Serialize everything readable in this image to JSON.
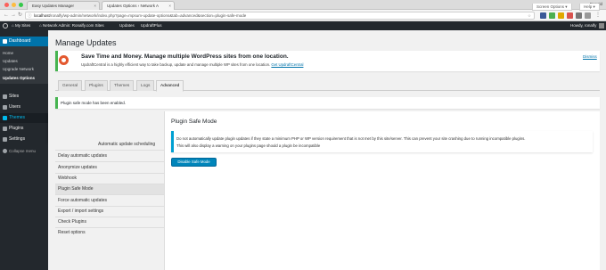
{
  "browser": {
    "tabs": [
      {
        "label": "Easy Updates Manager",
        "active": false
      },
      {
        "label": "Updates Options ‹ Network A",
        "active": true
      }
    ],
    "profile": "Ronald",
    "url_host": "localhost",
    "url_path": "/ronalfy/wp-admin/network/index.php?page=mpsum-update-options&tab=advanced&section=plugin-safe-mode"
  },
  "adminbar": {
    "my_sites": "My Sites",
    "network": "Network Admin: Ronalfy.com Sites",
    "updates": "Updates",
    "updraft": "UpdraftPlus",
    "howdy": "Howdy, ronalfy"
  },
  "sidebar": {
    "dashboard": "Dashboard",
    "dashboard_sub": [
      "Home",
      "Updates",
      "Upgrade Network",
      "Updates Options"
    ],
    "items": [
      "Sites",
      "Users",
      "Themes",
      "Plugins",
      "Settings"
    ],
    "collapse": "Collapse menu",
    "themes_flyout": [
      "Installed Themes",
      "Add New",
      "Editor"
    ]
  },
  "screen_options": "Screen Options ▾",
  "help": "Help ▾",
  "page_title": "Manage Updates",
  "notice": {
    "heading": "Save Time and Money. Manage multiple WordPress sites from one location.",
    "text": "UpdraftCentral is a highly efficient way to take backup, update and manage multiple WP sites from one location.",
    "link": "Get UpdraftCentral",
    "dismiss": "Dismiss"
  },
  "tabs": [
    "General",
    "Plugins",
    "Themes",
    "Logs",
    "Advanced"
  ],
  "success_message": "Plugin safe mode has been enabled.",
  "advanced_nav": [
    "Automatic update scheduling",
    "Delay automatic updates",
    "Anonymize updates",
    "Webhook",
    "Plugin Safe Mode",
    "Force automatic updates",
    "Export / import settings",
    "Check Plugins",
    "Reset options"
  ],
  "advanced_nav_active": "Plugin Safe Mode",
  "panel": {
    "title": "Plugin Safe Mode",
    "info_line1": "Do not automatically update plugin updates if they state a minimum PHP or WP version requirement that is not met by this site/server. This can prevent your site crashing due to running incompatible plugins.",
    "info_line2": "This will also display a warning on your plugins page should a plugin be incompatible",
    "button": "Disable Safe Mode"
  },
  "colors": {
    "wp_blue": "#0073aa",
    "button_blue": "#0085ba",
    "success_green": "#46b450",
    "info_blue": "#00a0d2",
    "updraft_orange": "#e3582f"
  }
}
